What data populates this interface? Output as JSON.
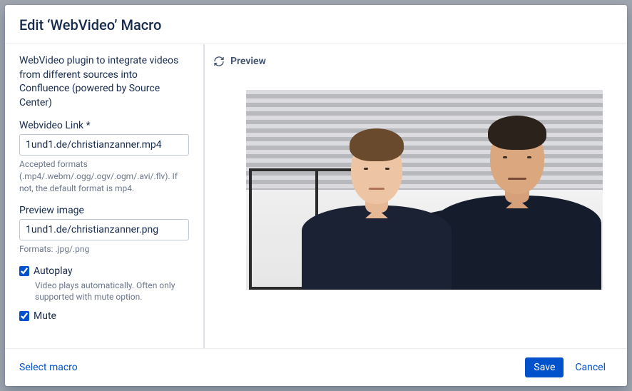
{
  "dialog": {
    "title": "Edit ‘WebVideo’ Macro"
  },
  "form": {
    "description": "WebVideo plugin to integrate videos from different sources into Confluence (powered by Source Center)",
    "link": {
      "label": "Webvideo Link *",
      "value": "1und1.de/christianzanner.mp4",
      "hint": "Accepted formats (.mp4/.webm/.ogg/.ogv/.ogm/.avi/.flv). If not, the default format is mp4."
    },
    "preview_image": {
      "label": "Preview image",
      "value": "1und1.de/christianzanner.png",
      "hint": "Formats: .jpg/.png"
    },
    "autoplay": {
      "label": "Autoplay",
      "checked": true,
      "hint": "Video plays automatically. Often only supported with mute option."
    },
    "mute": {
      "label": "Mute",
      "checked": true
    }
  },
  "preview": {
    "title": "Preview"
  },
  "footer": {
    "select_macro": "Select macro",
    "save": "Save",
    "cancel": "Cancel"
  }
}
